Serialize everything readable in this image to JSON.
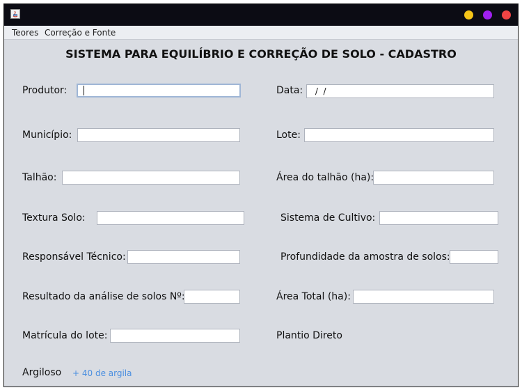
{
  "window": {
    "buttons": [
      {
        "name": "minimize",
        "color": "#f5c518"
      },
      {
        "name": "maximize",
        "color": "#a020f0"
      },
      {
        "name": "close",
        "color": "#ef4444"
      }
    ]
  },
  "menu": {
    "items": [
      "Teores",
      "Correção e Fonte"
    ]
  },
  "form": {
    "title": "SISTEMA PARA EQUILÍBRIO E CORREÇÃO DE SOLO - CADASTRO",
    "left": {
      "produtor_label": "Produtor:",
      "produtor_value": "",
      "municipio_label": "Município:",
      "municipio_value": "",
      "talhao_label": "Talhão:",
      "talhao_value": "",
      "textura_label": "Textura Solo:",
      "textura_value": "",
      "responsavel_label": "Responsável Técnico:",
      "responsavel_value": "",
      "resultado_label": "Resultado da análise de solos Nº:",
      "resultado_value": "",
      "matricula_label": "Matrícula do lote:",
      "matricula_value": ""
    },
    "right": {
      "data_label": "Data:",
      "data_value": " /  /",
      "lote_label": "Lote:",
      "lote_value": "",
      "area_talhao_label": "Área do talhão (ha):",
      "area_talhao_value": "",
      "sistema_label": "Sistema de Cultivo:",
      "sistema_value": "",
      "profundidade_label": "Profundidade da amostra de solos:",
      "profundidade_value": "",
      "area_total_label": "Área Total (ha):",
      "area_total_value": "",
      "plantio_text": "Plantio Direto"
    },
    "argiloso_text": "Argiloso",
    "argila_hint": "+ 40 de argila"
  }
}
